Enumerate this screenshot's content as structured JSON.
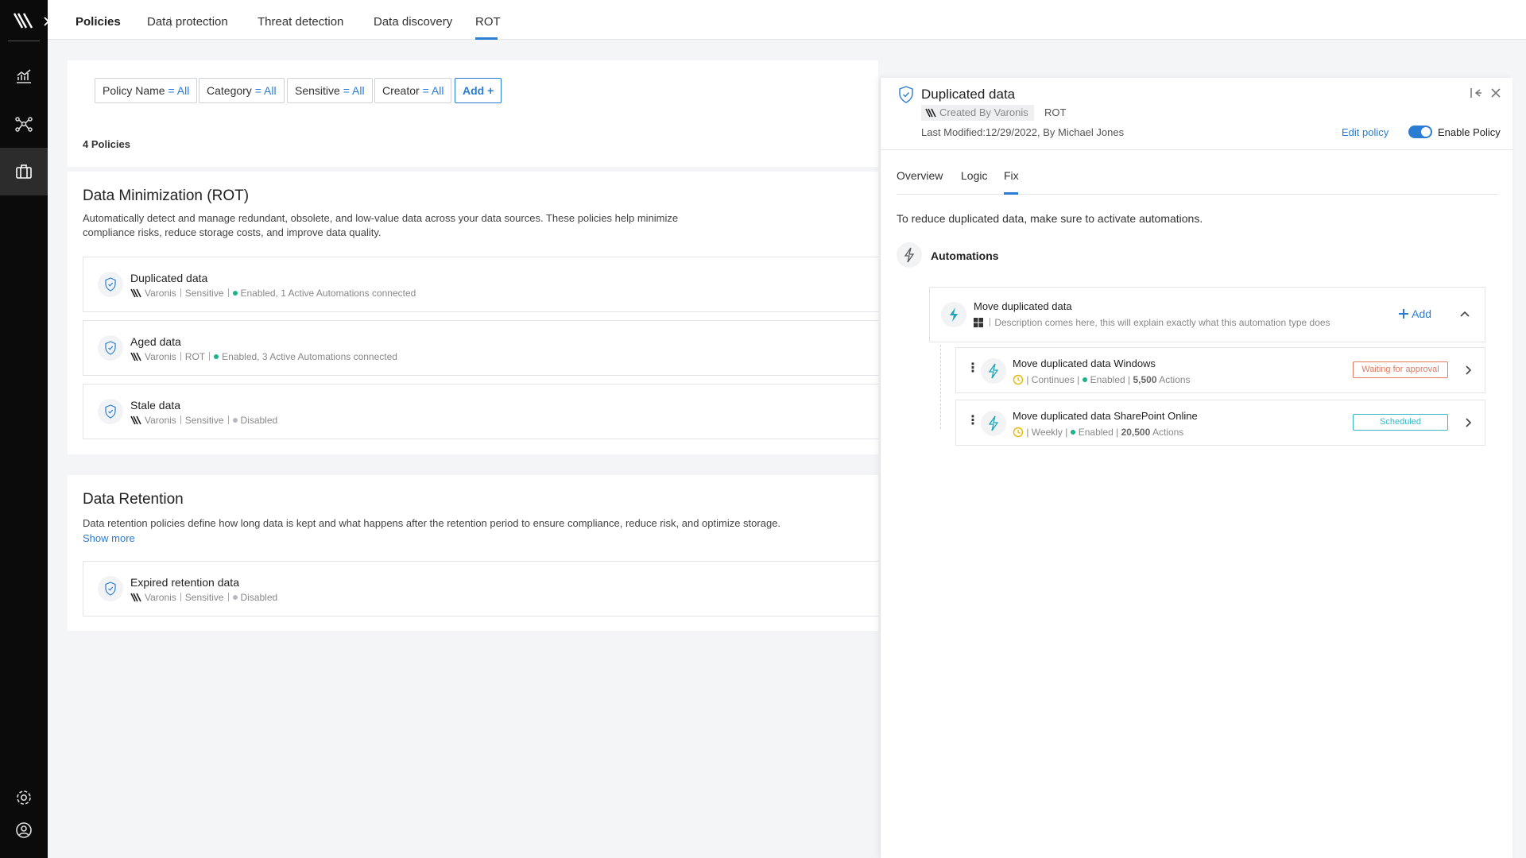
{
  "nav": {
    "tabs": [
      {
        "label": "Policies"
      },
      {
        "label": "Data protection"
      },
      {
        "label": "Threat detection"
      },
      {
        "label": "Data discovery"
      },
      {
        "label": "ROT"
      }
    ]
  },
  "filters": {
    "chips": [
      {
        "name": "Policy Name",
        "eq": "=",
        "value": "All"
      },
      {
        "name": "Category",
        "eq": "=",
        "value": "All"
      },
      {
        "name": "Sensitive",
        "eq": "=",
        "value": "All"
      },
      {
        "name": "Creator",
        "eq": "=",
        "value": "All"
      }
    ],
    "add_label": "Add",
    "count": "4 Policies"
  },
  "sections": [
    {
      "title": "Data Minimization (ROT)",
      "desc": "Automatically detect and manage redundant, obsolete, and low-value data across your data sources. These policies help minimize compliance risks, reduce storage costs, and improve data quality.",
      "policies": [
        {
          "title": "Duplicated data",
          "creator": "Varonis",
          "category": "Sensitive",
          "status": "Enabled, 1 Active Automations connected"
        },
        {
          "title": "Aged data",
          "creator": "Varonis",
          "category": "ROT",
          "status": "Enabled, 3 Active Automations connected"
        },
        {
          "title": "Stale data",
          "creator": "Varonis",
          "category": "Sensitive",
          "status": "Disabled"
        }
      ]
    },
    {
      "title": "Data Retention",
      "desc": "Data retention policies define how long data is kept and what happens after the retention period to ensure compliance, reduce risk, and optimize storage.",
      "show_more": "Show more",
      "policies": [
        {
          "title": "Expired retention data",
          "creator": "Varonis",
          "category": "Sensitive",
          "status": "Disabled"
        }
      ]
    }
  ],
  "panel": {
    "title": "Duplicated data",
    "created_by": "Created By Varonis",
    "category": "ROT",
    "modified": "Last Modified:12/29/2022, By Michael Jones",
    "edit_label": "Edit policy",
    "enable_label": "Enable Policy",
    "enabled": true,
    "tabs": [
      {
        "label": "Overview"
      },
      {
        "label": "Logic"
      },
      {
        "label": "Fix"
      }
    ],
    "active_tab": "Fix",
    "fix_text": "To reduce duplicated data, make sure to activate automations.",
    "automations_title": "Automations",
    "group": {
      "title": "Move duplicated data",
      "desc": "Description comes here, this will explain exactly what this automation type does",
      "add_label": "Add"
    },
    "automations": [
      {
        "title": "Move duplicated data Windows",
        "schedule": "Continues",
        "state": "Enabled",
        "actions_count": "5,500",
        "actions_word": "Actions",
        "status": "Waiting for approval"
      },
      {
        "title": "Move duplicated data SharePoint Online",
        "schedule": "Weekly",
        "state": "Enabled",
        "actions_count": "20,500",
        "actions_word": "Actions",
        "status": "Scheduled"
      }
    ]
  },
  "colors": {
    "accent": "#2b7cd3",
    "enabled_dot": "#1bb38a",
    "waiting": "#e07a5f",
    "scheduled": "#37b7c6"
  }
}
